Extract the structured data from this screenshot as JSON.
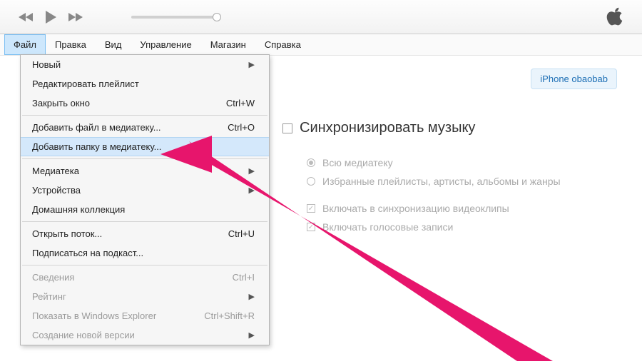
{
  "menubar": {
    "items": [
      "Файл",
      "Правка",
      "Вид",
      "Управление",
      "Магазин",
      "Справка"
    ]
  },
  "dropdown": {
    "items": [
      {
        "label": "Новый",
        "submenu": true
      },
      {
        "label": "Редактировать плейлист"
      },
      {
        "label": "Закрыть окно",
        "shortcut": "Ctrl+W"
      },
      {
        "sep": true
      },
      {
        "label": "Добавить файл в медиатеку...",
        "shortcut": "Ctrl+O"
      },
      {
        "label": "Добавить папку в медиатеку...",
        "highlight": true
      },
      {
        "sep": true
      },
      {
        "label": "Медиатека",
        "submenu": true
      },
      {
        "label": "Устройства",
        "submenu": true
      },
      {
        "label": "Домашняя коллекция"
      },
      {
        "sep": true
      },
      {
        "label": "Открыть поток...",
        "shortcut": "Ctrl+U"
      },
      {
        "label": "Подписаться на подкаст..."
      },
      {
        "sep": true
      },
      {
        "label": "Сведения",
        "shortcut": "Ctrl+I",
        "disabled": true
      },
      {
        "label": "Рейтинг",
        "submenu": true,
        "disabled": true
      },
      {
        "label": "Показать в Windows Explorer",
        "shortcut": "Ctrl+Shift+R",
        "disabled": true
      },
      {
        "label": "Создание новой версии",
        "submenu": true,
        "disabled": true
      }
    ]
  },
  "device": {
    "label": "iPhone obaobab"
  },
  "sync": {
    "heading": "Синхронизировать музыку",
    "opt_full": "Всю медиатеку",
    "opt_selected": "Избранные плейлисты, артисты, альбомы и жанры",
    "chk_videos": "Включать в синхронизацию видеоклипы",
    "chk_voice": "Включать голосовые записи"
  }
}
